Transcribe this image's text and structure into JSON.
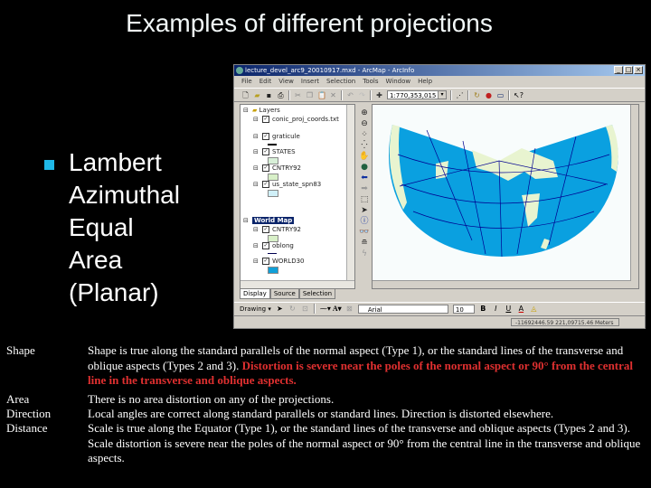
{
  "slide": {
    "title": "Examples of different projections",
    "bullet_lines": [
      "Lambert",
      "Azimuthal",
      "Equal",
      "Area",
      "(Planar)"
    ],
    "bullet_color": "#1fb8e8"
  },
  "arcmap": {
    "window_title": "lecture_devel_arc9_20010917.mxd - ArcMap - ArcInfo",
    "window_buttons": [
      "_",
      "□",
      "×"
    ],
    "menu": [
      "File",
      "Edit",
      "View",
      "Insert",
      "Selection",
      "Tools",
      "Window",
      "Help"
    ],
    "scale_value": "1:770,353,015",
    "toc": {
      "layers_group": "Layers",
      "layers": [
        "conic_proj_coords.txt",
        "graticule",
        "STATES",
        "CNTRY92",
        "us_state_spn83"
      ],
      "world_map_group": "World Map",
      "world_map_layers": [
        "CNTRY92",
        "oblong",
        "WORLD30"
      ],
      "tabs": [
        "Display",
        "Source",
        "Selection"
      ]
    },
    "drawing_label": "Drawing",
    "font_name": "Arial",
    "font_size": "10",
    "coordinates": "-11692446.59  221,09715.46 Meters",
    "colors": {
      "ocean": "#0aa0e0",
      "land": "#e8f4d0",
      "graticule": "#000090"
    }
  },
  "properties": [
    {
      "label": "Shape",
      "text_normal": "Shape is true along the standard parallels of the normal aspect (Type 1), or the standard lines of the transverse and oblique aspects (Types 2 and 3). ",
      "text_highlight": "Distortion is severe near the poles of the normal aspect or 90° from the central line in the transverse and oblique aspects."
    },
    {
      "label": "Area",
      "text_normal": "There is no area distortion on any of the projections."
    },
    {
      "label": "Direction",
      "text_normal": "Local angles are correct along standard parallels or standard lines. Direction is distorted elsewhere."
    },
    {
      "label": "Distance",
      "text_normal": "Scale is true along the Equator (Type 1), or the standard lines of the transverse and oblique aspects (Types 2 and 3). Scale distortion is severe near the poles of the normal aspect or 90° from the central line in the transverse and oblique aspects."
    }
  ]
}
